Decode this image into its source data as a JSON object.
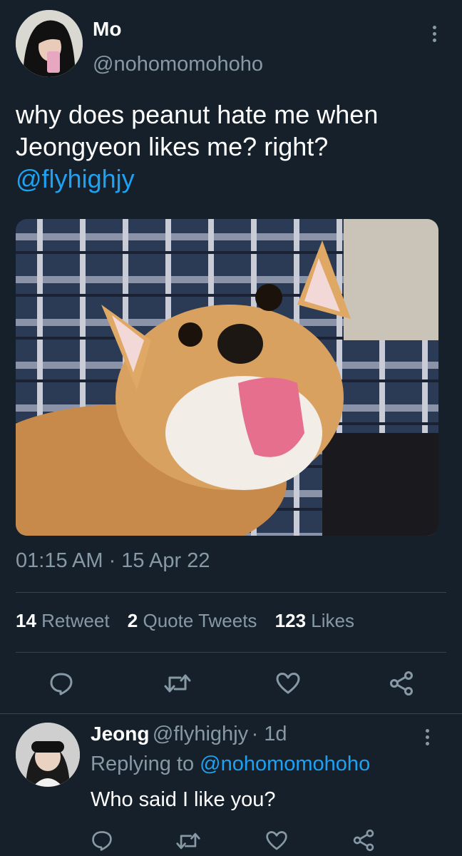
{
  "main_tweet": {
    "author_name": "Mo",
    "author_handle": "@nohomomohoho",
    "text": "why does peanut hate me when Jeongyeon likes me? right?",
    "mention": "@flyhighjy",
    "timestamp": "01:15 AM · 15 Apr 22",
    "stats": {
      "retweet_count": "14",
      "retweet_label": "Retweet",
      "quote_count": "2",
      "quote_label": "Quote Tweets",
      "like_count": "123",
      "like_label": "Likes"
    }
  },
  "reply": {
    "author_name": "Jeong",
    "author_handle": "@flyhighjy",
    "time_ago": "· 1d",
    "replying_prefix": "Replying to",
    "replying_to": "@nohomomohoho",
    "text": "Who said I like you?"
  },
  "icons": [
    "more-vertical-icon",
    "reply-icon",
    "retweet-icon",
    "like-icon",
    "share-icon"
  ],
  "colors": {
    "background": "#15202b",
    "text": "#ffffff",
    "secondary": "#8899a6",
    "accent": "#1da1f2",
    "divider": "#38444d"
  }
}
